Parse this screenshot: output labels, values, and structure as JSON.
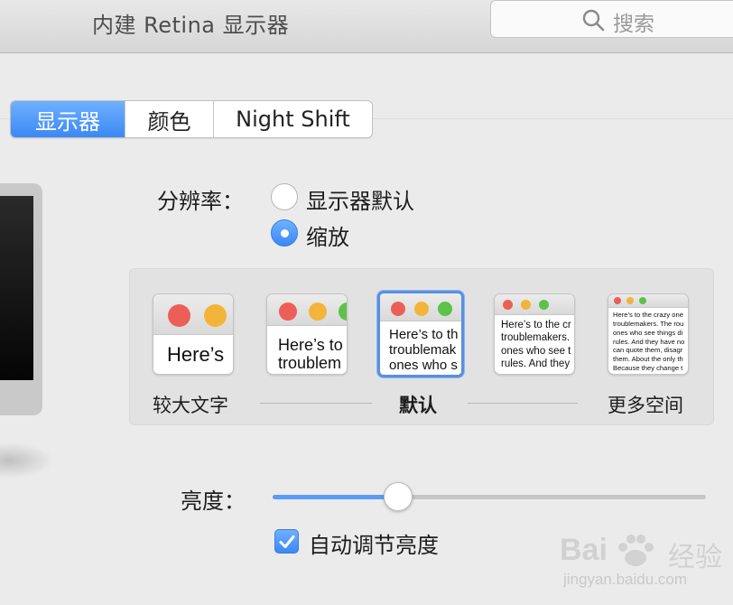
{
  "window": {
    "title": "内建 Retina 显示器"
  },
  "search": {
    "placeholder": "搜索",
    "icon": "search-icon"
  },
  "tabs": [
    {
      "label": "显示器",
      "active": true
    },
    {
      "label": "颜色",
      "active": false
    },
    {
      "label": "Night Shift",
      "active": false
    }
  ],
  "resolution": {
    "label": "分辨率：",
    "options": [
      {
        "label": "显示器默认",
        "selected": false
      },
      {
        "label": "缩放",
        "selected": true
      }
    ]
  },
  "scaling": {
    "options": [
      {
        "text": "Here’s"
      },
      {
        "text": "Here’s to th\ntroublem"
      },
      {
        "text": "Here’s to th\ntroublemak\nones who s"
      },
      {
        "text": "Here’s to the cr\ntroublemakers.\nones who see t\nrules. And they"
      },
      {
        "text": "Here’s to the crazy one\ntroublemakers. The rou\nones who see things di\nrules. And they have no\ncan quote them, disagr\nthem. About the only th\nBecause they change t"
      }
    ],
    "selected_index": 2,
    "captions": {
      "left": "较大文字",
      "center": "默认",
      "right": "更多空间"
    }
  },
  "brightness": {
    "label": "亮度：",
    "level": 0.29,
    "auto_label": "自动调节亮度",
    "auto_checked": true
  },
  "colors": {
    "accent": "#3b88f5",
    "slider_fill": "#5a9cf6"
  },
  "watermark": {
    "brand": "Bai",
    "brand_cn": "经验",
    "url": "jingyan.baidu.com"
  }
}
